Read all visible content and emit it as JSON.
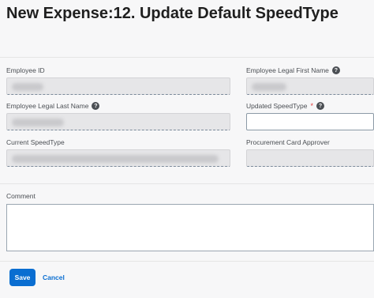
{
  "page": {
    "title": "New Expense:12. Update Default SpeedType"
  },
  "form": {
    "employee_id": {
      "label": "Employee ID",
      "value": ""
    },
    "employee_first_name": {
      "label": "Employee Legal First Name",
      "value": ""
    },
    "employee_last_name": {
      "label": "Employee Legal Last Name",
      "value": ""
    },
    "updated_speedtype": {
      "label": "Updated SpeedType",
      "required": "*",
      "value": ""
    },
    "current_speedtype": {
      "label": "Current SpeedType",
      "value": ""
    },
    "procurement_approver": {
      "label": "Procurement Card Approver",
      "value": ""
    },
    "comment": {
      "label": "Comment",
      "value": ""
    }
  },
  "actions": {
    "save_label": "Save",
    "cancel_label": "Cancel"
  },
  "icons": {
    "help": "question-circle-icon"
  },
  "colors": {
    "accent": "#0a6ed1",
    "required": "#e23b3b"
  }
}
